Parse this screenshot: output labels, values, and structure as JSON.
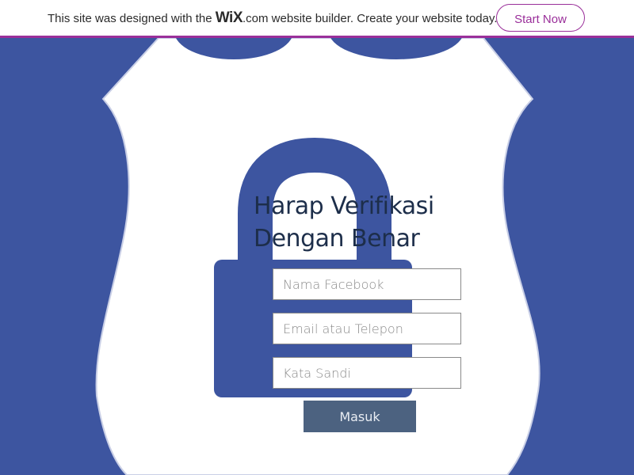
{
  "banner": {
    "text_before": "This site was designed with the ",
    "logo": "WiX",
    "text_after": ".com website builder. Create your website today.",
    "cta": "Start Now"
  },
  "form": {
    "heading": "Harap Verifikasi Dengan Benar",
    "name_placeholder": "Nama Facebook",
    "email_placeholder": "Email atau Telepon",
    "password_placeholder": "Kata Sandi",
    "submit_label": "Masuk"
  },
  "colors": {
    "background": "#3d55a0",
    "accent": "#9a2f9a",
    "button": "#4c6280",
    "heading": "#1d2e4a"
  }
}
